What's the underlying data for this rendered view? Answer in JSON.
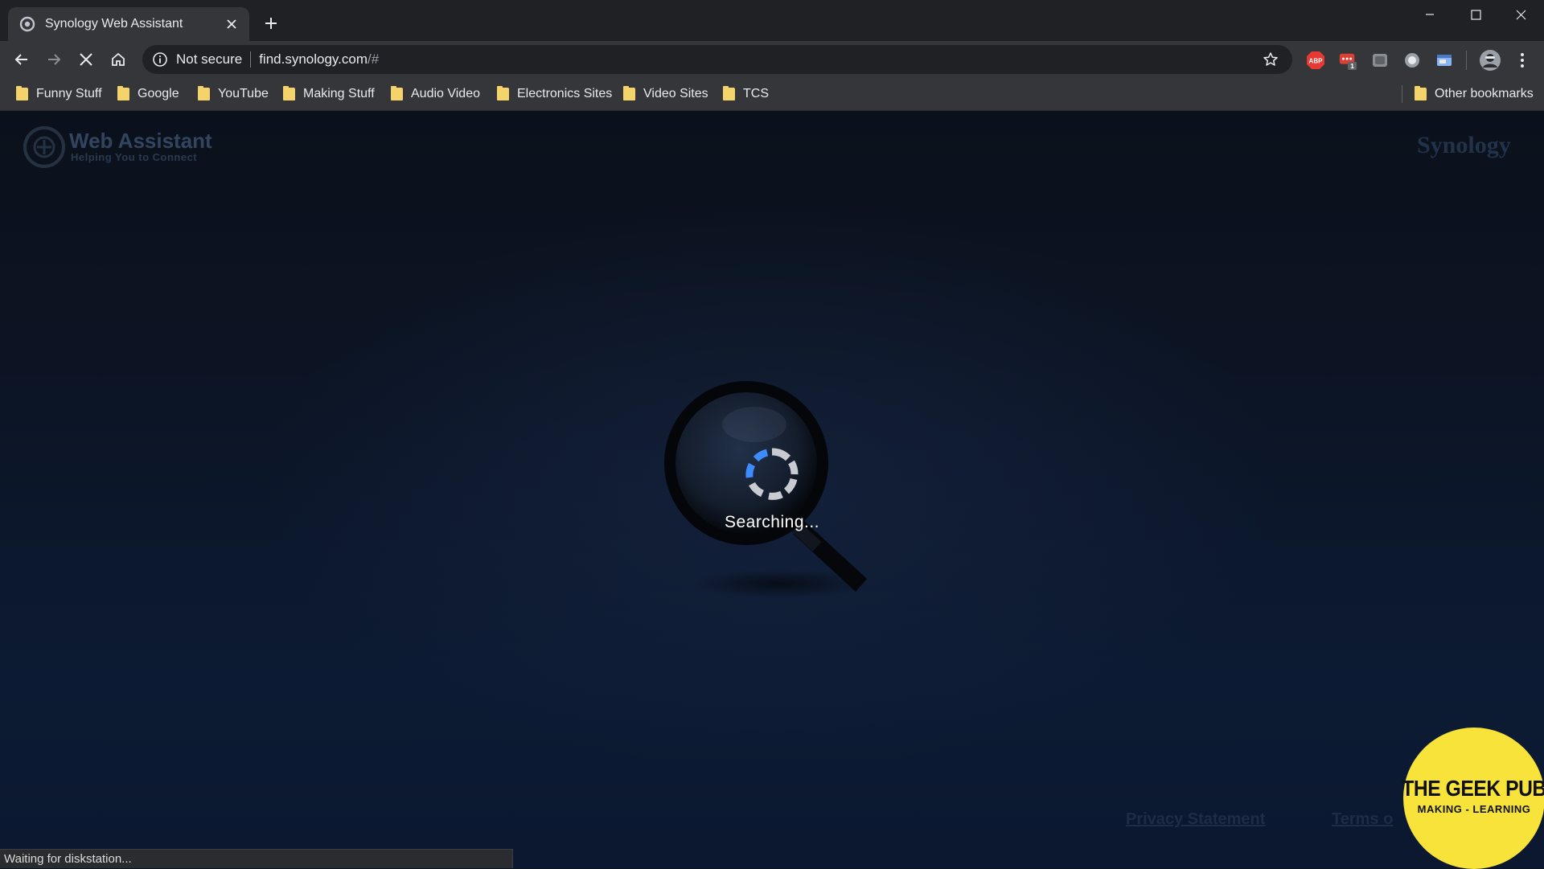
{
  "browser": {
    "tab": {
      "title": "Synology Web Assistant"
    },
    "address_bar": {
      "security_label": "Not secure",
      "url_host": "find.synology.com",
      "url_rest": "/#"
    },
    "extensions": [
      {
        "icon": "adblock-plus-icon",
        "label": "ABP"
      },
      {
        "icon": "todoist-extension-icon",
        "badge": "1"
      },
      {
        "icon": "screenshot-extension-icon"
      },
      {
        "icon": "record-extension-icon"
      },
      {
        "icon": "window-extension-icon"
      }
    ],
    "bookmarks": [
      "Funny Stuff",
      "Google",
      "YouTube",
      "Making Stuff",
      "Audio Video",
      "Electronics Sites",
      "Video Sites",
      "TCS"
    ],
    "other_bookmarks": "Other bookmarks",
    "status_text": "Waiting for diskstation..."
  },
  "page": {
    "logo_title": "Web Assistant",
    "logo_subtitle": "Helping You to Connect",
    "brand": "Synology",
    "status": "Searching...",
    "footer": {
      "privacy": "Privacy Statement",
      "terms": "Terms o"
    }
  },
  "watermark": {
    "title": "THE GEEK PUB",
    "subtitle": "MAKING - LEARNING"
  },
  "colors": {
    "accent_blue": "#3d8bfd",
    "spinner_gray": "#c8ccd2",
    "watermark_yellow": "#f7e33a"
  }
}
